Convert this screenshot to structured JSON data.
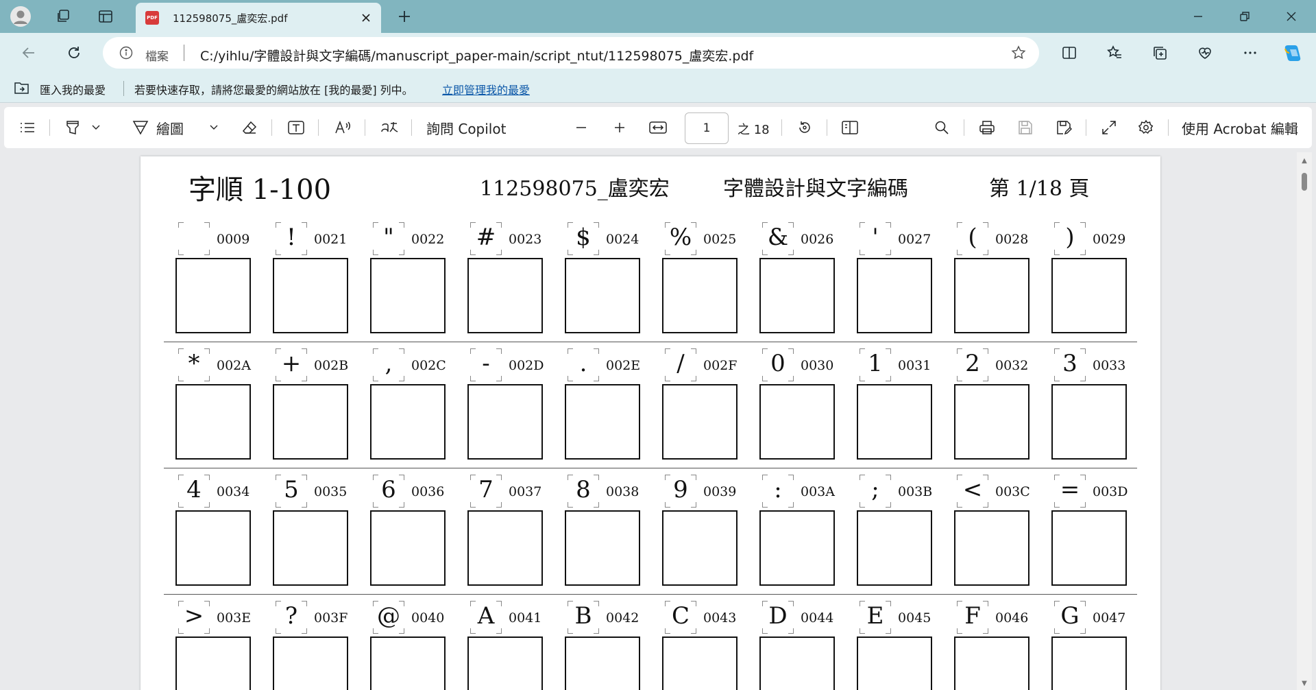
{
  "browser": {
    "tab_title": "112598075_盧奕宏.pdf",
    "tab_favicon": "PDF",
    "address": {
      "file_label": "檔案",
      "url": "C:/yihlu/字體設計與文字編碼/manuscript_paper-main/script_ntut/112598075_盧奕宏.pdf"
    },
    "favorites": {
      "import_label": "匯入我的最愛",
      "hint": "若要快速存取，請將您最愛的網站放在 [我的最愛] 列中。",
      "manage_link": "立即管理我的最愛"
    }
  },
  "pdf_toolbar": {
    "draw_label": "繪圖",
    "copilot_label": "詢問 Copilot",
    "page_current": "1",
    "page_total": "之 18",
    "acrobat_label": "使用 Acrobat 編輯"
  },
  "document": {
    "header_title": "字順 1-100",
    "header_id": "112598075_盧奕宏",
    "header_course": "字體設計與文字編碼",
    "header_page": "第 1/18 頁",
    "rows": [
      [
        {
          "glyph": "",
          "code": "0009"
        },
        {
          "glyph": "!",
          "code": "0021"
        },
        {
          "glyph": "\"",
          "code": "0022"
        },
        {
          "glyph": "#",
          "code": "0023"
        },
        {
          "glyph": "$",
          "code": "0024"
        },
        {
          "glyph": "%",
          "code": "0025"
        },
        {
          "glyph": "&",
          "code": "0026"
        },
        {
          "glyph": "'",
          "code": "0027"
        },
        {
          "glyph": "(",
          "code": "0028"
        },
        {
          "glyph": ")",
          "code": "0029"
        }
      ],
      [
        {
          "glyph": "*",
          "code": "002A"
        },
        {
          "glyph": "+",
          "code": "002B"
        },
        {
          "glyph": ",",
          "code": "002C"
        },
        {
          "glyph": "-",
          "code": "002D"
        },
        {
          "glyph": ".",
          "code": "002E"
        },
        {
          "glyph": "/",
          "code": "002F"
        },
        {
          "glyph": "0",
          "code": "0030"
        },
        {
          "glyph": "1",
          "code": "0031"
        },
        {
          "glyph": "2",
          "code": "0032"
        },
        {
          "glyph": "3",
          "code": "0033"
        }
      ],
      [
        {
          "glyph": "4",
          "code": "0034"
        },
        {
          "glyph": "5",
          "code": "0035"
        },
        {
          "glyph": "6",
          "code": "0036"
        },
        {
          "glyph": "7",
          "code": "0037"
        },
        {
          "glyph": "8",
          "code": "0038"
        },
        {
          "glyph": "9",
          "code": "0039"
        },
        {
          "glyph": ":",
          "code": "003A"
        },
        {
          "glyph": ";",
          "code": "003B"
        },
        {
          "glyph": "<",
          "code": "003C"
        },
        {
          "glyph": "=",
          "code": "003D"
        }
      ],
      [
        {
          "glyph": ">",
          "code": "003E"
        },
        {
          "glyph": "?",
          "code": "003F"
        },
        {
          "glyph": "@",
          "code": "0040"
        },
        {
          "glyph": "A",
          "code": "0041"
        },
        {
          "glyph": "B",
          "code": "0042"
        },
        {
          "glyph": "C",
          "code": "0043"
        },
        {
          "glyph": "D",
          "code": "0044"
        },
        {
          "glyph": "E",
          "code": "0045"
        },
        {
          "glyph": "F",
          "code": "0046"
        },
        {
          "glyph": "G",
          "code": "0047"
        }
      ]
    ]
  }
}
